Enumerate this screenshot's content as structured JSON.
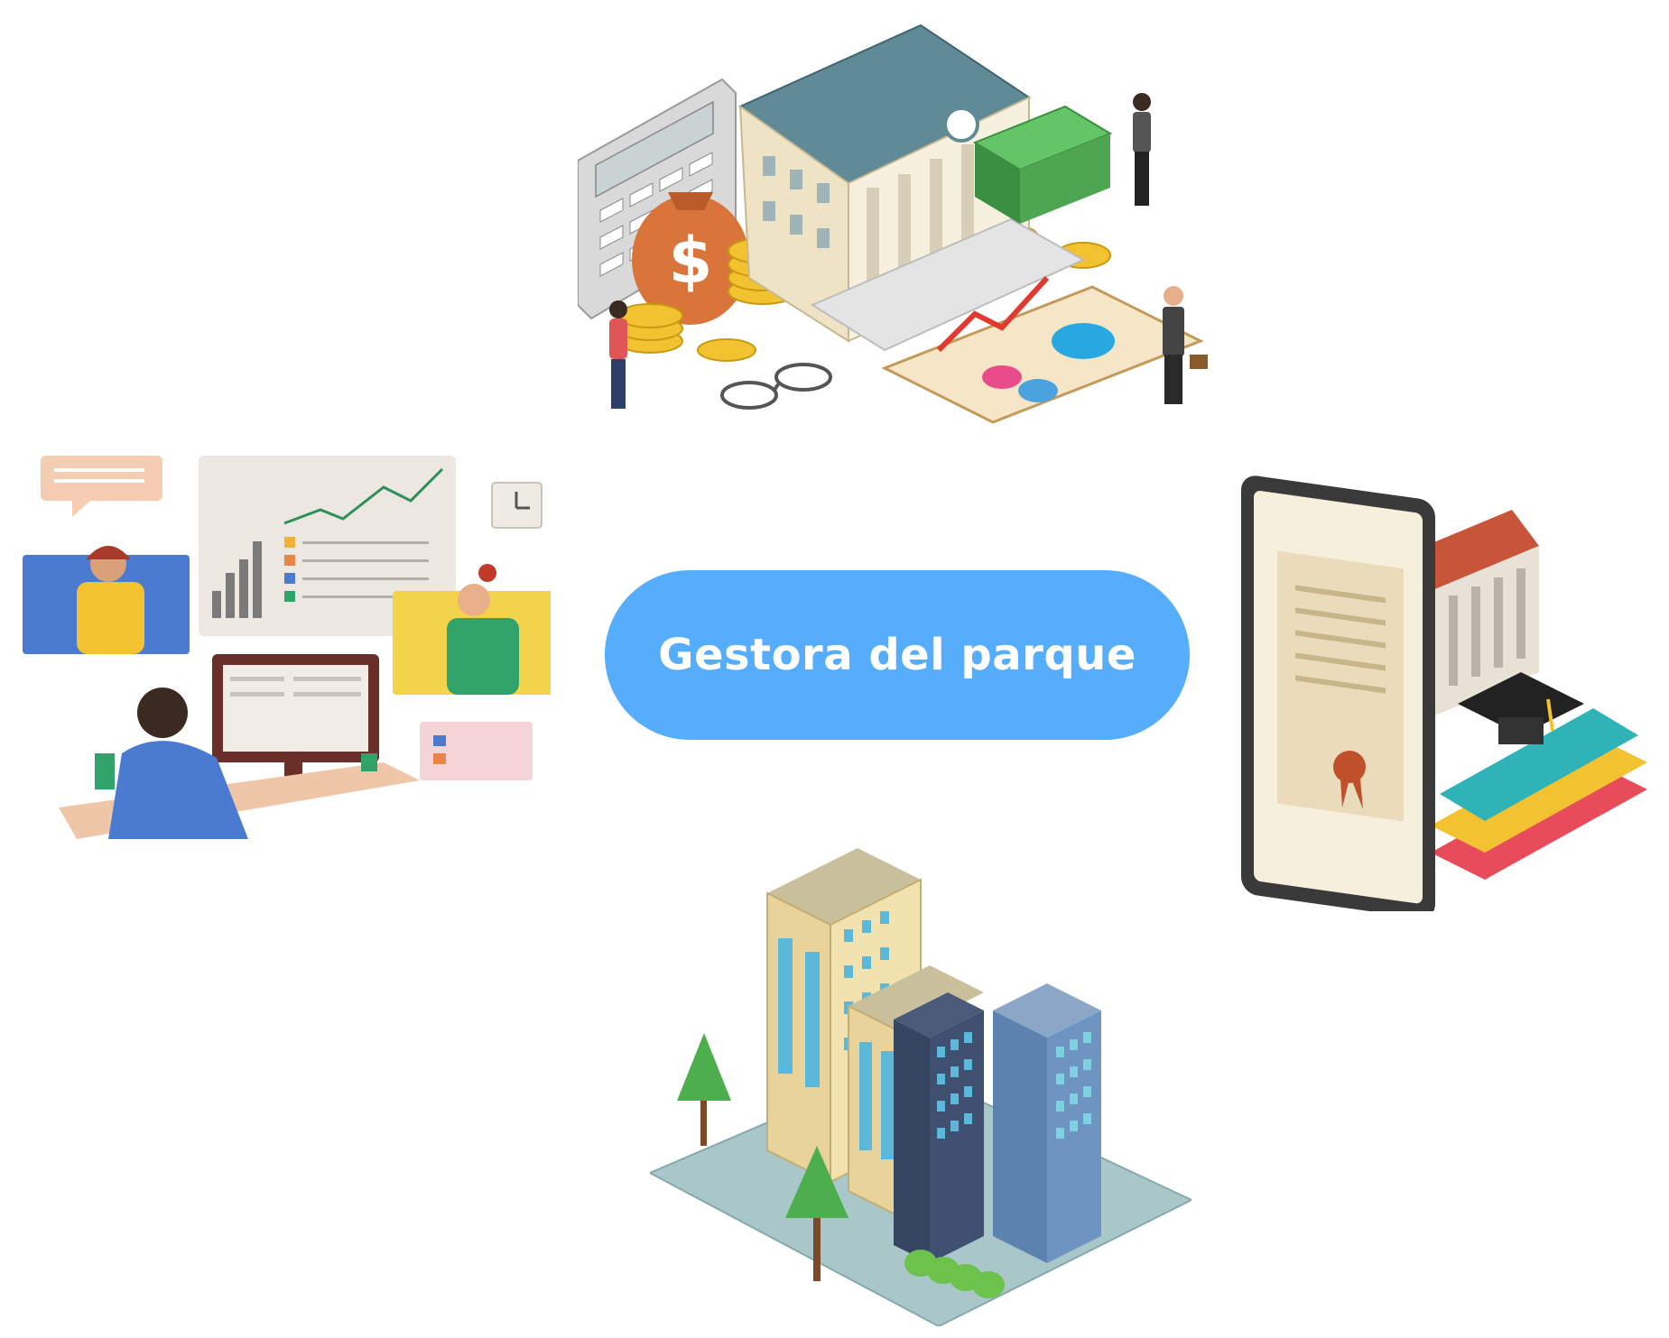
{
  "center": {
    "label": "Gestora del parque",
    "color": "#56adfb"
  },
  "nodes": [
    {
      "icon": "bank-finance-illustration"
    },
    {
      "icon": "online-meeting-office-illustration"
    },
    {
      "icon": "education-certificate-illustration"
    },
    {
      "icon": "city-buildings-illustration"
    }
  ],
  "colors": {
    "accent": "#56adfb",
    "background": "#ffffff"
  }
}
